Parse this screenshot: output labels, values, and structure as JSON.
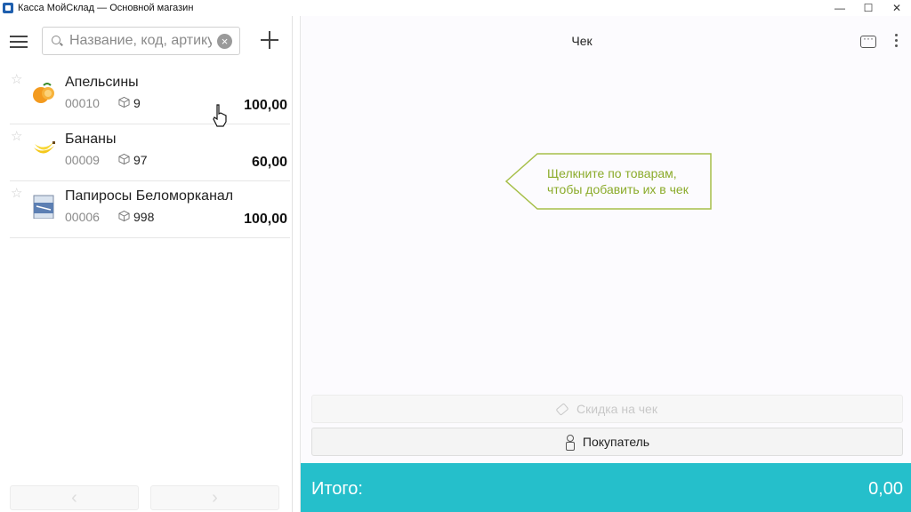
{
  "window": {
    "title": "Касса МойСклад — Основной магазин",
    "minimize": "—",
    "maximize": "☐",
    "close": "✕"
  },
  "left_panel": {
    "search": {
      "placeholder": "Название, код, артикул",
      "value": ""
    },
    "products": [
      {
        "name": "Апельсины",
        "code": "00010",
        "stock": "9",
        "price": "100,00",
        "icon": "orange-icon"
      },
      {
        "name": "Бананы",
        "code": "00009",
        "stock": "97",
        "price": "60,00",
        "icon": "banana-icon"
      },
      {
        "name": "Папиросы Беломорканал",
        "code": "00006",
        "stock": "998",
        "price": "100,00",
        "icon": "cigarettes-icon"
      }
    ],
    "pager": {
      "prev": "‹",
      "next": "›"
    }
  },
  "receipt": {
    "title": "Чек",
    "hint": "Щелкните по товарам, чтобы добавить их в чек",
    "discount_button": "Скидка на чек",
    "customer_button": "Покупатель",
    "total_label": "Итого:",
    "total_value": "0,00"
  },
  "colors": {
    "total_bar": "#25bfcb",
    "hint": "#8bab2a"
  }
}
